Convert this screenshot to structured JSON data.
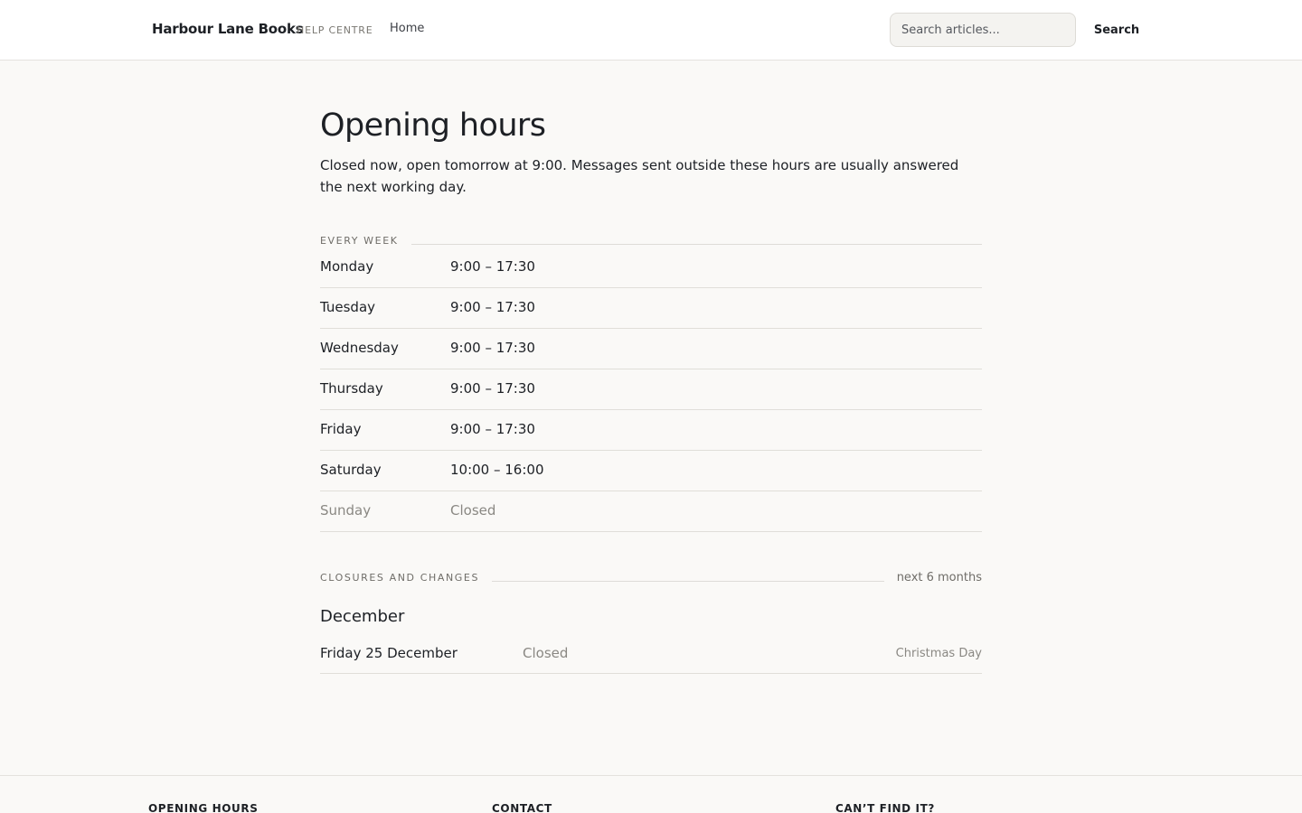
{
  "header": {
    "brand": "Harbour Lane Books",
    "section_tag": "HELP CENTRE",
    "nav_home": "Home",
    "search_placeholder": "Search articles...",
    "search_button": "Search"
  },
  "page": {
    "title": "Opening hours",
    "intro": "Closed now, open tomorrow at 9:00. Messages sent outside these hours are usually answered the next working day."
  },
  "weekly": {
    "label": "EVERY WEEK",
    "days": [
      {
        "day": "Monday",
        "hours": "9:00 – 17:30"
      },
      {
        "day": "Tuesday",
        "hours": "9:00 – 17:30"
      },
      {
        "day": "Wednesday",
        "hours": "9:00 – 17:30"
      },
      {
        "day": "Thursday",
        "hours": "9:00 – 17:30"
      },
      {
        "day": "Friday",
        "hours": "9:00 – 17:30"
      },
      {
        "day": "Saturday",
        "hours": "10:00 – 16:00"
      },
      {
        "day": "Sunday",
        "hours": "Closed"
      }
    ]
  },
  "closures": {
    "label": "CLOSURES AND CHANGES",
    "range_note": "next 6 months",
    "month": "December",
    "items": [
      {
        "date": "Friday 25 December",
        "status": "Closed",
        "reason": "Christmas Day"
      }
    ]
  },
  "footer": {
    "col1": "OPENING HOURS",
    "col2": "CONTACT",
    "col3": "CAN’T FIND IT?"
  }
}
